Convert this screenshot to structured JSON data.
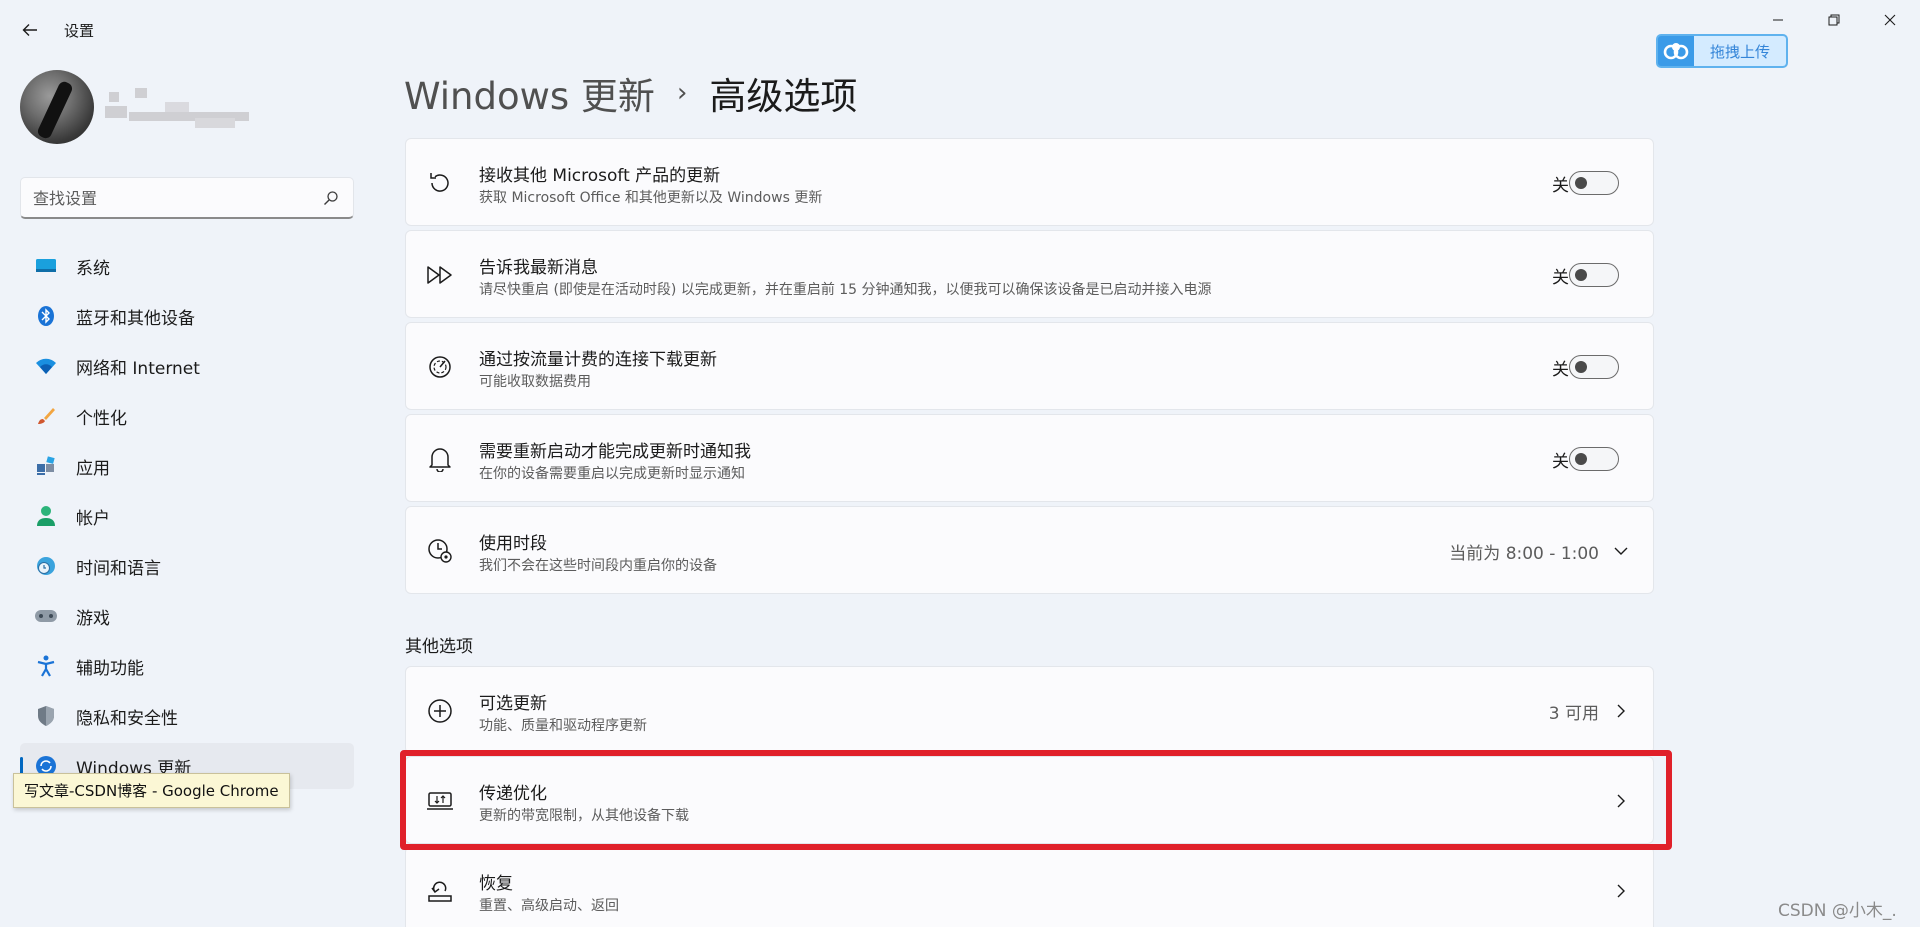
{
  "window": {
    "title": "设置",
    "controls": {
      "minimize": "minimize-icon",
      "maximize": "restore-icon",
      "close": "close-icon"
    }
  },
  "upload": {
    "label": "拖拽上传",
    "accent": "#3b9be8"
  },
  "sidebar": {
    "search_placeholder": "查找设置",
    "items": [
      {
        "label": "系统",
        "icon": "monitor-icon"
      },
      {
        "label": "蓝牙和其他设备",
        "icon": "bluetooth-icon"
      },
      {
        "label": "网络和 Internet",
        "icon": "wifi-icon"
      },
      {
        "label": "个性化",
        "icon": "brush-icon"
      },
      {
        "label": "应用",
        "icon": "apps-icon"
      },
      {
        "label": "帐户",
        "icon": "person-icon"
      },
      {
        "label": "时间和语言",
        "icon": "globe-clock-icon"
      },
      {
        "label": "游戏",
        "icon": "gamepad-icon"
      },
      {
        "label": "辅助功能",
        "icon": "accessibility-icon"
      },
      {
        "label": "隐私和安全性",
        "icon": "shield-icon"
      },
      {
        "label": "Windows 更新",
        "icon": "windows-update-icon",
        "active": true
      }
    ]
  },
  "tooltip": {
    "text": "写文章-CSDN博客 - Google Chrome"
  },
  "breadcrumb": {
    "parent": "Windows 更新",
    "current": "高级选项"
  },
  "settings": [
    {
      "title": "接收其他 Microsoft 产品的更新",
      "desc": "获取 Microsoft Office 和其他更新以及 Windows 更新",
      "state": "关",
      "icon": "refresh-icon"
    },
    {
      "title": "告诉我最新消息",
      "desc": "请尽快重启 (即使是在活动时段) 以完成更新，并在重启前 15 分钟通知我，以便我可以确保该设备是已启动并接入电源",
      "state": "关",
      "icon": "fast-forward-icon"
    },
    {
      "title": "通过按流量计费的连接下载更新",
      "desc": "可能收取数据费用",
      "state": "关",
      "icon": "speedometer-icon"
    },
    {
      "title": "需要重新启动才能完成更新时通知我",
      "desc": "在你的设备需要重启以完成更新时显示通知",
      "state": "关",
      "icon": "bell-icon"
    },
    {
      "title": "使用时段",
      "desc": "我们不会在这些时间段内重启你的设备",
      "value": "当前为 8:00 - 1:00",
      "icon": "clock-gear-icon"
    }
  ],
  "other_options": {
    "title": "其他选项",
    "items": [
      {
        "title": "可选更新",
        "desc": "功能、质量和驱动程序更新",
        "value": "3 可用",
        "icon": "plus-circle-icon"
      },
      {
        "title": "传递优化",
        "desc": "更新的带宽限制，从其他设备下载",
        "icon": "delivery-optimization-icon"
      },
      {
        "title": "恢复",
        "desc": "重置、高级启动、返回",
        "icon": "recovery-icon"
      }
    ]
  },
  "highlight_color": "#e0202a",
  "watermark": "CSDN @小木_."
}
